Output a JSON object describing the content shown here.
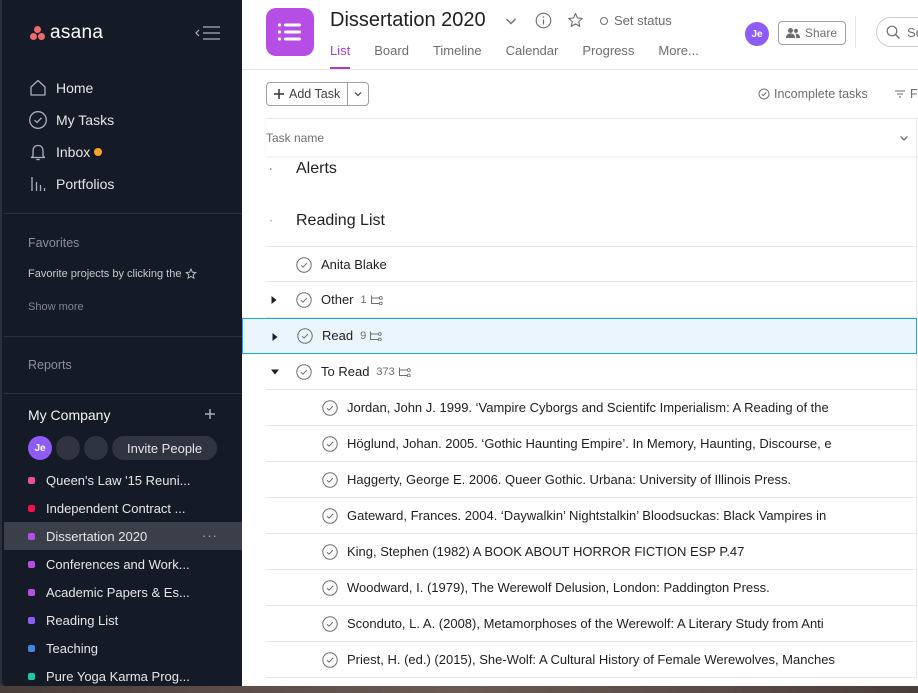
{
  "app": {
    "logo_text": "asana"
  },
  "sidebar": {
    "nav": [
      {
        "label": "Home",
        "icon": "home-icon"
      },
      {
        "label": "My Tasks",
        "icon": "check-circle-icon"
      },
      {
        "label": "Inbox",
        "icon": "bell-icon",
        "has_notification": true
      },
      {
        "label": "Portfolios",
        "icon": "bar-chart-icon"
      }
    ],
    "favorites_title": "Favorites",
    "favorites_hint": "Favorite projects by clicking the",
    "show_more": "Show more",
    "reports_title": "Reports",
    "team_title": "My Company",
    "member_initials": "Je",
    "invite_label": "Invite People",
    "projects": [
      {
        "label": "Queen's Law '15 Reuni...",
        "color": "#ea4e9d"
      },
      {
        "label": "Independent Contract ...",
        "color": "#f0104a"
      },
      {
        "label": "Dissertation 2020",
        "color": "#b64ee6",
        "active": true,
        "more": "···"
      },
      {
        "label": "Conferences and Work...",
        "color": "#b64ee6"
      },
      {
        "label": "Academic Papers & Es...",
        "color": "#b64ee6"
      },
      {
        "label": "Reading List",
        "color": "#8d5cf6"
      },
      {
        "label": "Teaching",
        "color": "#4186e0"
      },
      {
        "label": "Pure Yoga Karma Prog...",
        "color": "#19c9a6"
      }
    ]
  },
  "header": {
    "project_title": "Dissertation 2020",
    "project_color": "#b64ee6",
    "set_status": "Set status",
    "tabs": [
      {
        "label": "List",
        "active": true
      },
      {
        "label": "Board"
      },
      {
        "label": "Timeline"
      },
      {
        "label": "Calendar"
      },
      {
        "label": "Progress"
      },
      {
        "label": "More..."
      }
    ],
    "avatar_initials": "Je",
    "share_label": "Share",
    "search_placeholder": "Se"
  },
  "toolbar": {
    "add_task_label": "Add Task",
    "incomplete_label": "Incomplete tasks",
    "filter_label": "F"
  },
  "list": {
    "column_header": "Task name",
    "sections": [
      {
        "title": "Alerts",
        "expanded": false
      },
      {
        "title": "Reading List",
        "expanded": true
      }
    ],
    "tasks": [
      {
        "name": "Anita Blake"
      },
      {
        "name": "Other",
        "subtask_count": "1",
        "expandable": true,
        "expanded": false
      },
      {
        "name": "Read",
        "subtask_count": "9",
        "expandable": true,
        "expanded": false,
        "selected": true
      },
      {
        "name": "To Read",
        "subtask_count": "373",
        "expandable": true,
        "expanded": true
      }
    ],
    "subtasks": [
      "Jordan, John J. 1999. ‘Vampire Cyborgs and Scientifc Imperialism: A Reading of the",
      "Höglund, Johan. 2005. ‘Gothic Haunting Empire’. In Memory, Haunting, Discourse, e",
      "Haggerty, George E. 2006. Queer Gothic. Urbana: University of Illinois Press.",
      "Gateward, Frances. 2004. ‘Daywalkin’ Nightstalkin’ Bloodsuckas: Black Vampires in",
      "King, Stephen (1982) A BOOK ABOUT HORROR FICTION ESP P.47",
      "Woodward, I. (1979), The Werewolf Delusion, London: Paddington Press.",
      "Sconduto, L. A. (2008), Metamorphoses of the Werewolf: A Literary Study from Anti",
      "Priest, H. (ed.) (2015), She-Wolf: A Cultural History of Female Werewolves, Manches"
    ]
  }
}
